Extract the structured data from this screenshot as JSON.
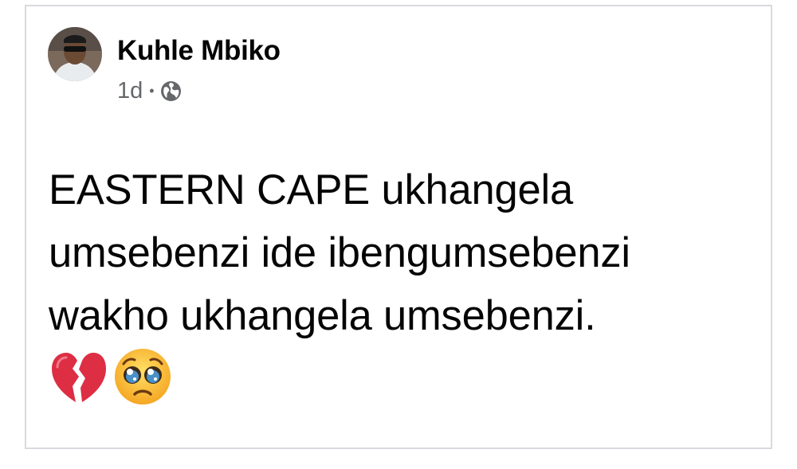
{
  "post": {
    "author_name": "Kuhle Mbiko",
    "timestamp": "1d",
    "separator": "•",
    "audience_icon": "globe-icon",
    "text": "EASTERN CAPE ukhangela\numsebenzi ide ibengumsebenzi\nwakho ukhangela umsebenzi.",
    "emojis": [
      "broken-heart-icon",
      "pleading-face-icon"
    ]
  },
  "colors": {
    "name": "#050505",
    "meta": "#65676b",
    "body_text": "#050505",
    "card_border": "#d8dadf"
  }
}
